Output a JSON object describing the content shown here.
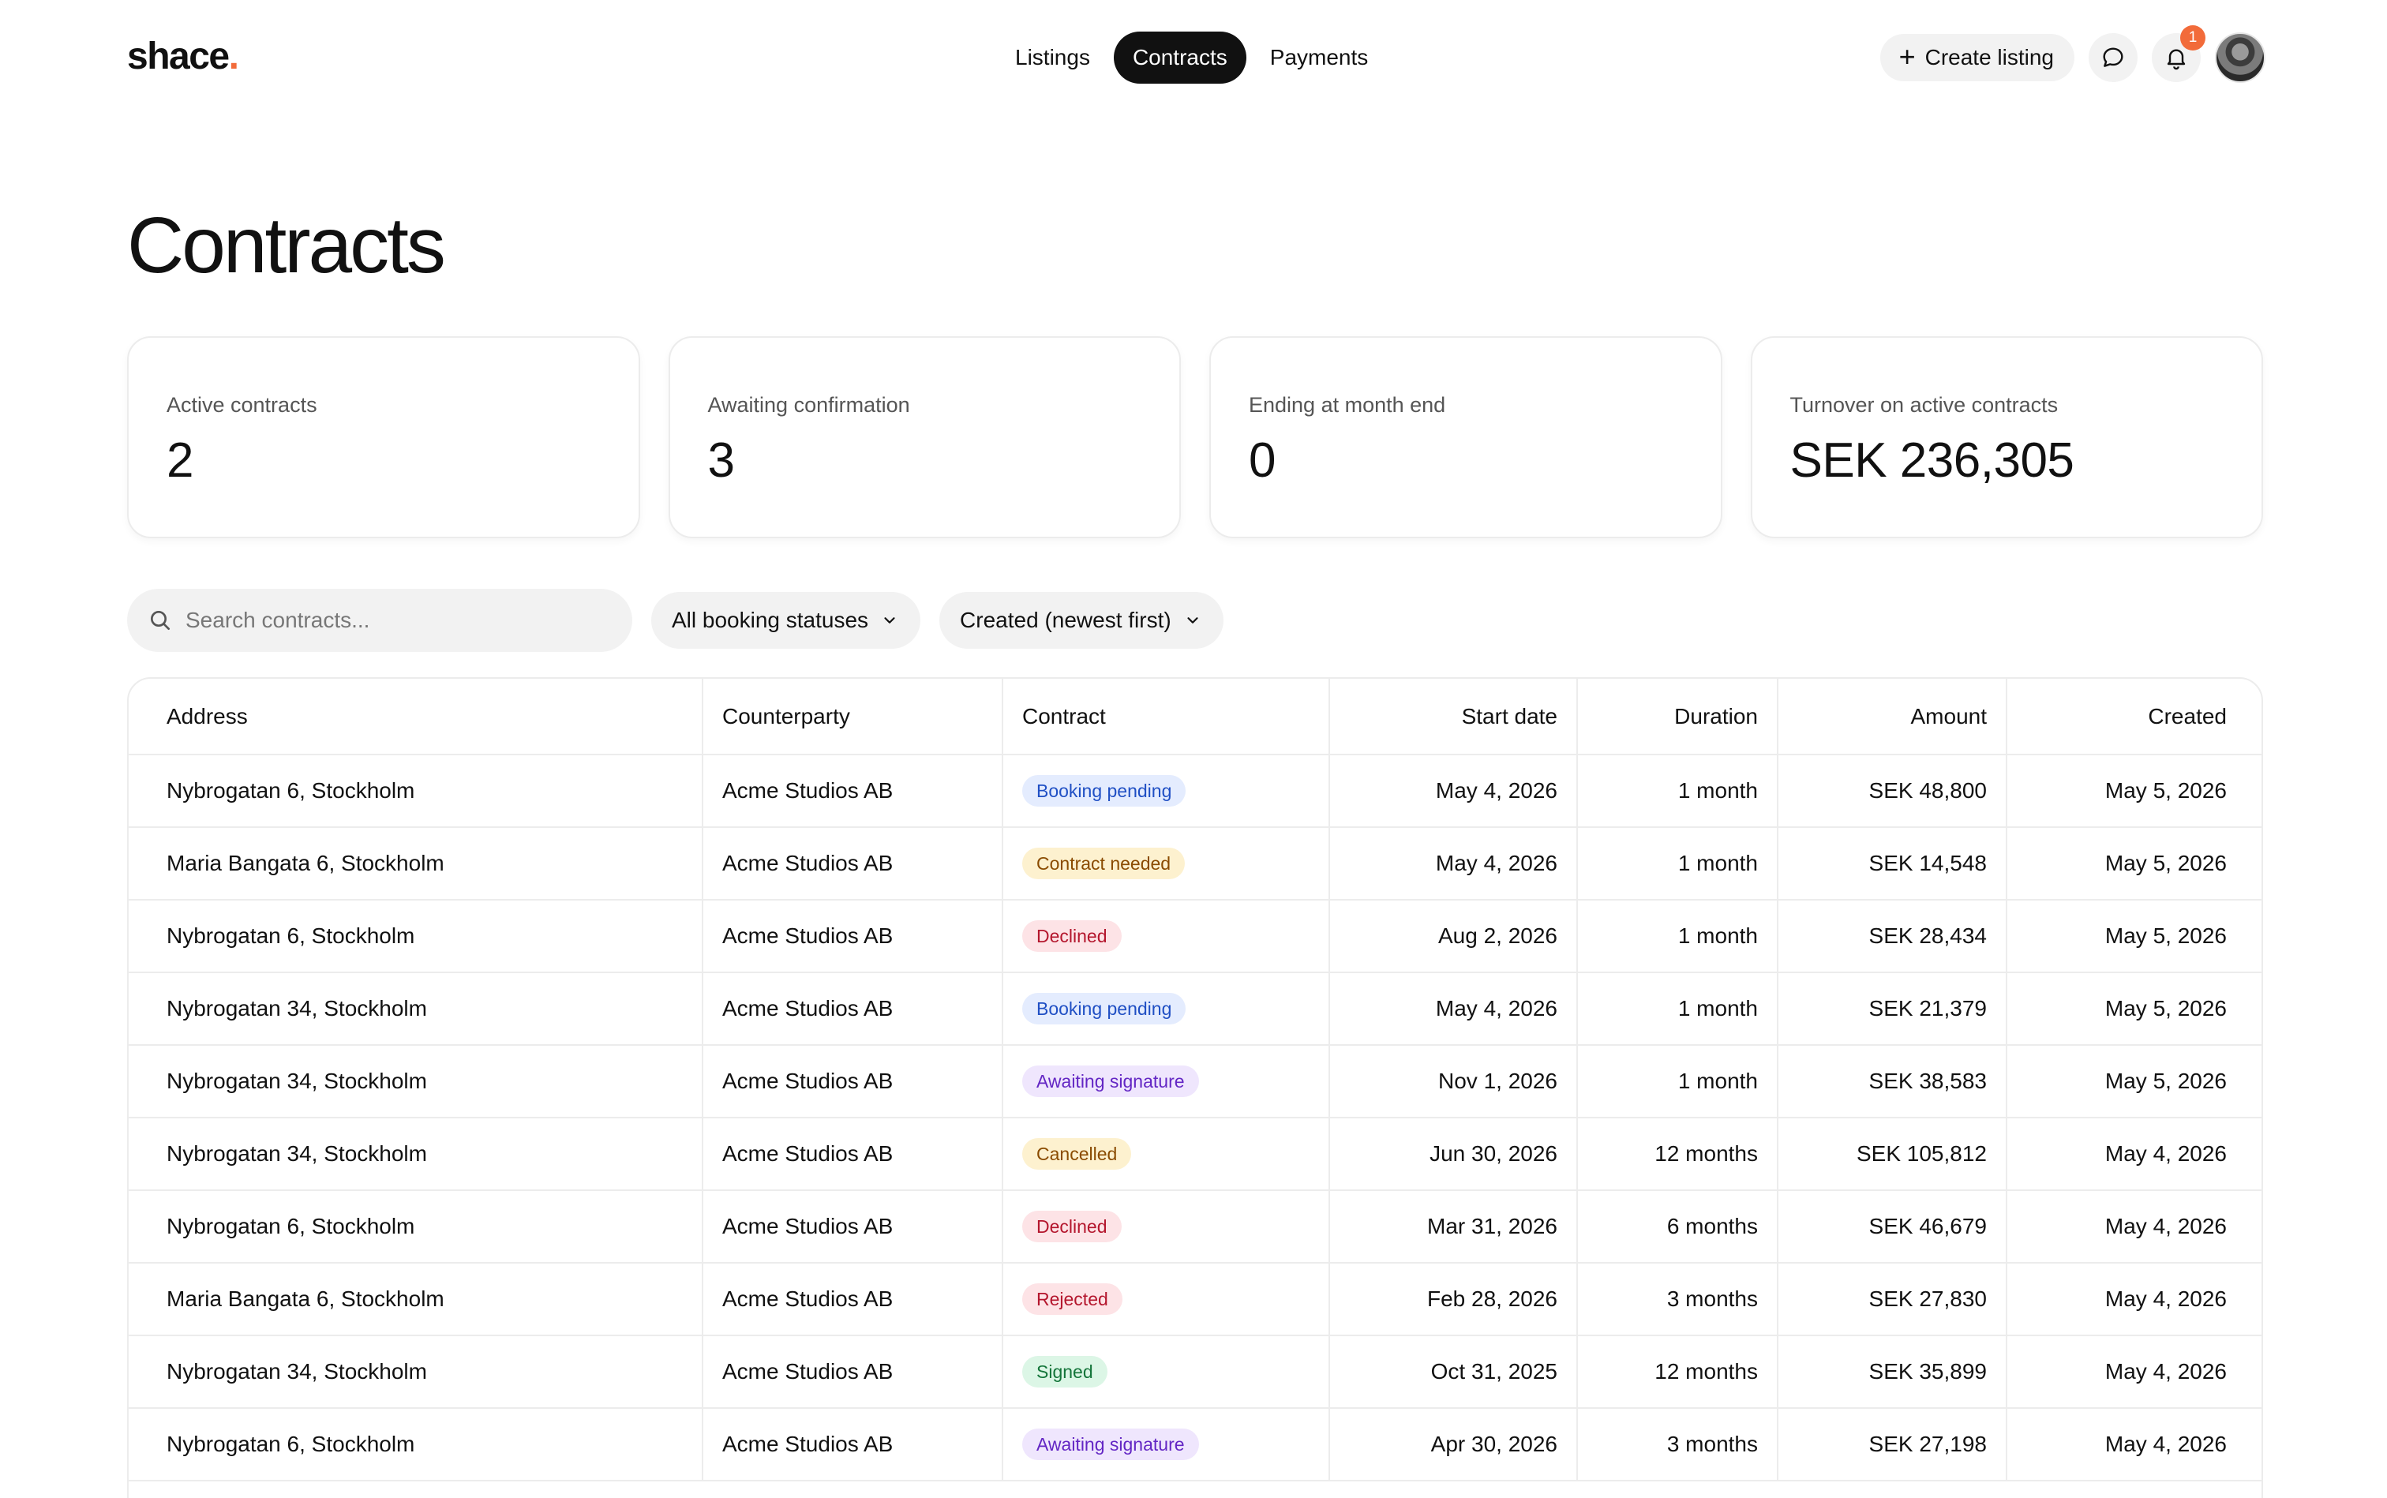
{
  "header": {
    "logo_text": "shace",
    "logo_dot": ".",
    "nav": [
      {
        "label": "Listings",
        "active": false
      },
      {
        "label": "Contracts",
        "active": true
      },
      {
        "label": "Payments",
        "active": false
      }
    ],
    "create_button": {
      "icon": "plus-icon",
      "label": "Create listing"
    },
    "messages_icon": "chat-bubble-icon",
    "notifications_icon": "bell-icon",
    "notification_count": "1",
    "accent_color": "#f26b3a"
  },
  "page": {
    "title": "Contracts"
  },
  "stats": [
    {
      "label": "Active contracts",
      "value": "2"
    },
    {
      "label": "Awaiting confirmation",
      "value": "3"
    },
    {
      "label": "Ending at month end",
      "value": "0"
    },
    {
      "label": "Turnover on active contracts",
      "value": "SEK 236,305"
    }
  ],
  "filters": {
    "search": {
      "icon": "search-icon",
      "placeholder": "Search contracts...",
      "value": ""
    },
    "status_select": {
      "value": "All booking statuses",
      "icon": "chevron-down-icon"
    },
    "sort_select": {
      "value": "Created (newest first)",
      "icon": "chevron-down-icon"
    }
  },
  "table": {
    "columns": {
      "address": "Address",
      "counterparty": "Counterparty",
      "contract": "Contract",
      "start_date": "Start date",
      "duration": "Duration",
      "amount": "Amount",
      "created": "Created"
    },
    "rows": [
      {
        "address": "Nybrogatan 6, Stockholm",
        "counterparty": "Acme Studios AB",
        "status": "Booking pending",
        "status_color": "blue",
        "start": "May 4, 2026",
        "duration": "1 month",
        "amount": "SEK 48,800",
        "created": "May 5, 2026"
      },
      {
        "address": "Maria Bangata 6, Stockholm",
        "counterparty": "Acme Studios AB",
        "status": "Contract needed",
        "status_color": "amber",
        "start": "May 4, 2026",
        "duration": "1 month",
        "amount": "SEK 14,548",
        "created": "May 5, 2026"
      },
      {
        "address": "Nybrogatan 6, Stockholm",
        "counterparty": "Acme Studios AB",
        "status": "Declined",
        "status_color": "red",
        "start": "Aug 2, 2026",
        "duration": "1 month",
        "amount": "SEK 28,434",
        "created": "May 5, 2026"
      },
      {
        "address": "Nybrogatan 34, Stockholm",
        "counterparty": "Acme Studios AB",
        "status": "Booking pending",
        "status_color": "blue",
        "start": "May 4, 2026",
        "duration": "1 month",
        "amount": "SEK 21,379",
        "created": "May 5, 2026"
      },
      {
        "address": "Nybrogatan 34, Stockholm",
        "counterparty": "Acme Studios AB",
        "status": "Awaiting signature",
        "status_color": "purple",
        "start": "Nov 1, 2026",
        "duration": "1 month",
        "amount": "SEK 38,583",
        "created": "May 5, 2026"
      },
      {
        "address": "Nybrogatan 34, Stockholm",
        "counterparty": "Acme Studios AB",
        "status": "Cancelled",
        "status_color": "amber",
        "start": "Jun 30, 2026",
        "duration": "12 months",
        "amount": "SEK 105,812",
        "created": "May 4, 2026"
      },
      {
        "address": "Nybrogatan 6, Stockholm",
        "counterparty": "Acme Studios AB",
        "status": "Declined",
        "status_color": "red",
        "start": "Mar 31, 2026",
        "duration": "6 months",
        "amount": "SEK 46,679",
        "created": "May 4, 2026"
      },
      {
        "address": "Maria Bangata 6, Stockholm",
        "counterparty": "Acme Studios AB",
        "status": "Rejected",
        "status_color": "red",
        "start": "Feb 28, 2026",
        "duration": "3 months",
        "amount": "SEK 27,830",
        "created": "May 4, 2026"
      },
      {
        "address": "Nybrogatan 34, Stockholm",
        "counterparty": "Acme Studios AB",
        "status": "Signed",
        "status_color": "green",
        "start": "Oct 31, 2025",
        "duration": "12 months",
        "amount": "SEK 35,899",
        "created": "May 4, 2026"
      },
      {
        "address": "Nybrogatan 6, Stockholm",
        "counterparty": "Acme Studios AB",
        "status": "Awaiting signature",
        "status_color": "purple",
        "start": "Apr 30, 2026",
        "duration": "3 months",
        "amount": "SEK 27,198",
        "created": "May 4, 2026"
      }
    ]
  }
}
